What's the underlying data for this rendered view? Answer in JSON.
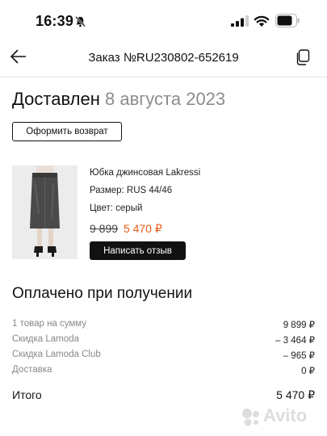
{
  "status_bar": {
    "time": "16:39",
    "icons": [
      "bell-slash-icon",
      "signal-icon",
      "wifi-icon",
      "battery-icon"
    ]
  },
  "nav": {
    "back_icon": "arrow-left-icon",
    "title": "Заказ №RU230802-652619",
    "copy_icon": "copy-icon"
  },
  "order": {
    "status": "Доставлен",
    "date": "8 августа 2023",
    "return_button": "Оформить возврат"
  },
  "product": {
    "name": "Юбка джинсовая Lakressi",
    "size": "Размер: RUS 44/46",
    "color": "Цвет: серый",
    "old_price": "9 899",
    "new_price": "5 470 ₽",
    "review_button": "Написать отзыв"
  },
  "payment": {
    "heading": "Оплачено при получении",
    "rows": [
      {
        "label": "1 товар на сумму",
        "value": "9 899 ₽"
      },
      {
        "label": "Скидка Lamoda",
        "value": "– 3 464 ₽"
      },
      {
        "label": "Скидка Lamoda Club",
        "value": "– 965 ₽"
      },
      {
        "label": "Доставка",
        "value": "0 ₽"
      }
    ],
    "total_label": "Итого",
    "total_value": "5 470 ₽"
  },
  "colors": {
    "accent_price": "#e85a1a",
    "muted_text": "#8c8c8c",
    "button_dark": "#111111"
  },
  "watermark": {
    "text": "Avito"
  }
}
